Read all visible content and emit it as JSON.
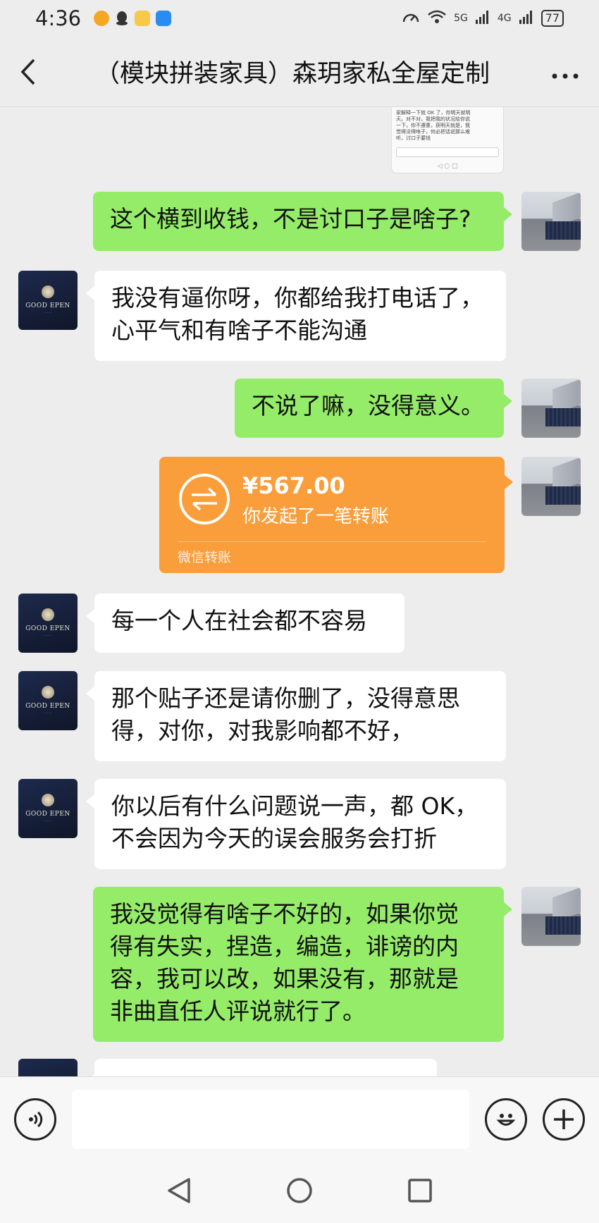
{
  "status_bar": {
    "time": "4:36",
    "network_1": "5G",
    "network_2": "4G",
    "battery": "77"
  },
  "header": {
    "title": "（模块拼装家具）森玥家私全屋定制"
  },
  "preview_image": {
    "text": "家解释一下就 OK 了，你明天就明\n天。对不对，我把我的状况给你说\n一下，你不遵重，获明天就是，我\n觉得没得啥子，何必把话说那么难\n听，讨口子要钱"
  },
  "messages": [
    {
      "side": "out",
      "text": "这个横到收钱，不是讨口子是啥子?"
    },
    {
      "side": "in",
      "text": "我没有逼你呀，你都给我打电话了，\n心平气和有啥子不能沟通"
    },
    {
      "side": "out",
      "text": "不说了嘛，没得意义。"
    },
    {
      "side": "in",
      "text": "每一个人在社会都不容易"
    },
    {
      "side": "in",
      "text": "那个贴子还是请你删了，没得意思\n得，对你，对我影响都不好，"
    },
    {
      "side": "in",
      "text": "你以后有什么问题说一声，都 OK，\n不会因为今天的误会服务会打折"
    },
    {
      "side": "out",
      "text": "我没觉得有啥子不好的，如果你觉\n得有失实，捏造，编造，诽谤的内\n容，我可以改，如果没有，那就是\n非曲直任人评说就行了。"
    }
  ],
  "transfer": {
    "amount": "¥567.00",
    "description": "你发起了一笔转账",
    "footer": "微信转账"
  },
  "brand_avatar": {
    "name": "GOOD EPEN"
  },
  "input_bar": {
    "placeholder": ""
  },
  "colors": {
    "outgoing_bubble": "#95ec69",
    "incoming_bubble": "#ffffff",
    "transfer": "#fa9d3b",
    "background": "#ededed"
  }
}
